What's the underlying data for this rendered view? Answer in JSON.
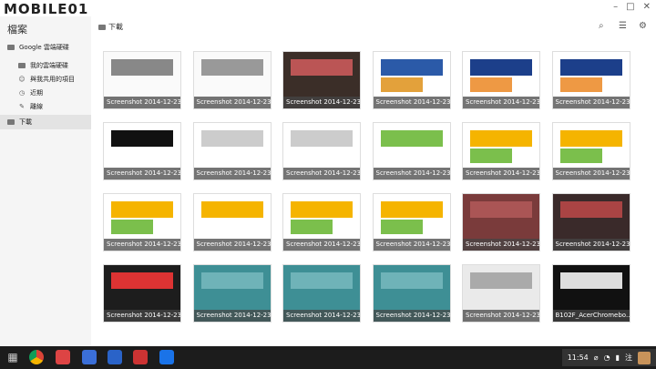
{
  "watermark": "MOBILE01",
  "sidebar": {
    "title": "檔案",
    "drive": "Google 雲端硬碟",
    "items": [
      "我的雲端硬碟",
      "與我共用的項目",
      "近期",
      "離線"
    ],
    "downloads": "下載"
  },
  "main": {
    "breadcrumb": "下載",
    "captions": [
      "Screenshot 2014-12-23...",
      "Screenshot 2014-12-23...",
      "Screenshot 2014-12-23...",
      "Screenshot 2014-12-23...",
      "Screenshot 2014-12-23...",
      "Screenshot 2014-12-23...",
      "Screenshot 2014-12-23...",
      "Screenshot 2014-12-23...",
      "Screenshot 2014-12-23...",
      "Screenshot 2014-12-23...",
      "Screenshot 2014-12-23...",
      "Screenshot 2014-12-23...",
      "Screenshot 2014-12-23...",
      "Screenshot 2014-12-23...",
      "Screenshot 2014-12-23...",
      "Screenshot 2014-12-23...",
      "Screenshot 2014-12-23...",
      "Screenshot 2014-12-23...",
      "Screenshot 2014-12-23...",
      "Screenshot 2014-12-23...",
      "Screenshot 2014-12-23...",
      "Screenshot 2014-12-23...",
      "Screenshot 2014-12-23...",
      "B102F_AcerChromebo..."
    ]
  },
  "taskbar": {
    "time": "11:54",
    "ime": "注"
  },
  "colors": {
    "taskbar": "#1c1c1c",
    "sidebar": "#f5f5f5",
    "accent": "#f5b400"
  }
}
